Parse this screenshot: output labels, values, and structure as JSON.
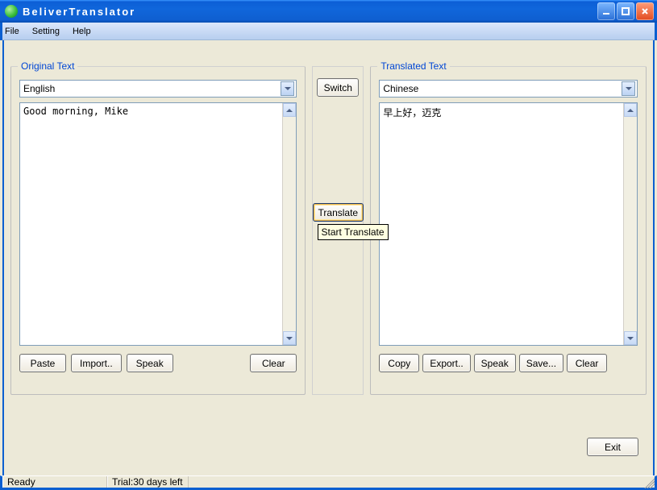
{
  "window": {
    "title": "BeliverTranslator"
  },
  "menu": {
    "file": "File",
    "setting": "Setting",
    "help": "Help"
  },
  "original": {
    "legend": "Original Text",
    "language": "English",
    "text": "Good morning, Mike",
    "paste": "Paste",
    "import": "Import..",
    "speak": "Speak",
    "clear": "Clear"
  },
  "mid": {
    "switch": "Switch",
    "translate": "Translate",
    "tooltip": "Start Translate"
  },
  "translated": {
    "legend": "Translated Text",
    "language": "Chinese",
    "text": "早上好，迈克",
    "copy": "Copy",
    "export": "Export..",
    "speak": "Speak",
    "save": "Save...",
    "clear": "Clear"
  },
  "exit": "Exit",
  "status": {
    "ready": "Ready",
    "trial": "Trial:30 days left"
  }
}
